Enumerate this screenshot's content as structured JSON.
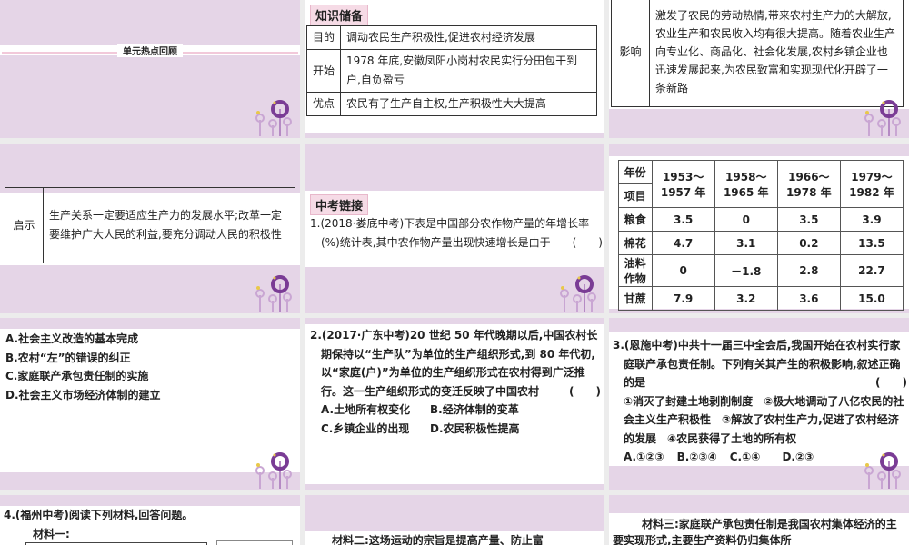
{
  "slide1": {
    "title": "单元热点回顾"
  },
  "slide2": {
    "tag": "知识储备",
    "rows": [
      {
        "label": "目的",
        "text": "调动农民生产积极性,促进农村经济发展"
      },
      {
        "label": "开始",
        "text": "1978 年底,安徽凤阳小岗村农民实行分田包干到户,自负盈亏"
      },
      {
        "label": "优点",
        "text": "农民有了生产自主权,生产积极性大大提高"
      }
    ]
  },
  "slide3": {
    "label": "影响",
    "text": "激发了农民的劳动热情,带来农村生产力的大解放,农业生产和农民收入均有很大提高。随着农业生产向专业化、商品化、社会化发展,农村乡镇企业也迅速发展起来,为农民致富和实现现代化开辟了一条新路"
  },
  "slide4": {
    "label": "启示",
    "text": "生产关系一定要适应生产力的发展水平;改革一定要维护广大人民的利益,要充分调动人民的积极性"
  },
  "slide5": {
    "tag": "中考链接",
    "question": "1.(2018·娄底中考)下表是中国部分农作物产量的年增长率(%)统计表,其中农作物产量出现快速增长是由于",
    "bracket": "(　　)"
  },
  "slide6": {
    "header_top": "年份",
    "header_bottom": "项目",
    "periods": [
      "1953～1957 年",
      "1958～1965 年",
      "1966～1978 年",
      "1979～1982 年"
    ],
    "rows": [
      {
        "item": "粮食",
        "values": [
          "3.5",
          "0",
          "3.5",
          "3.9"
        ]
      },
      {
        "item": "棉花",
        "values": [
          "4.7",
          "3.1",
          "0.2",
          "13.5"
        ]
      },
      {
        "item": "油料作物",
        "values": [
          "0",
          "－1.8",
          "2.8",
          "22.7"
        ]
      },
      {
        "item": "甘蔗",
        "values": [
          "7.9",
          "3.2",
          "3.6",
          "15.0"
        ]
      }
    ]
  },
  "slide7": {
    "options": [
      "A.社会主义改造的基本完成",
      "B.农村“左”的错误的纠正",
      "C.家庭联产承包责任制的实施",
      "D.社会主义市场经济体制的建立"
    ]
  },
  "slide8": {
    "question": "2.(2017·广东中考)20 世纪 50 年代晚期以后,中国农村长期保持以“生产队”为单位的生产组织形式,到 80 年代初,以“家庭(户)”为单位的生产组织形式在农村得到广泛推行。这一生产组织形式的变迁反映了中国农村",
    "bracket": "(　　)",
    "options": [
      "A.土地所有权变化",
      "B.经济体制的变革",
      "C.乡镇企业的出现",
      "D.农民积极性提高"
    ]
  },
  "slide9": {
    "question": "3.(恩施中考)中共十一届三中全会后,我国开始在农村实行家庭联产承包责任制。下列有关其产生的积极影响,叙述正确的是",
    "bracket": "(　　)",
    "statements": "①消灭了封建土地剥削制度　②极大地调动了八亿农民的社会主义生产积极性　③解放了农村生产力,促进了农村经济的发展　④农民获得了土地的所有权",
    "options": [
      "A.①②③",
      "B.②③④",
      "C.①④",
      "D.②③"
    ]
  },
  "slide10": {
    "question": "4.(福州中考)阅读下列材料,回答问题。",
    "material": "材料一:"
  },
  "slide11": {
    "material": "材料二:这场运动的宗旨是提高产量、防止富"
  },
  "slide12": {
    "material": "材料三:家庭联产承包责任制是我国农村集体经济的主要实现形式,主要生产资料仍归集体所"
  }
}
